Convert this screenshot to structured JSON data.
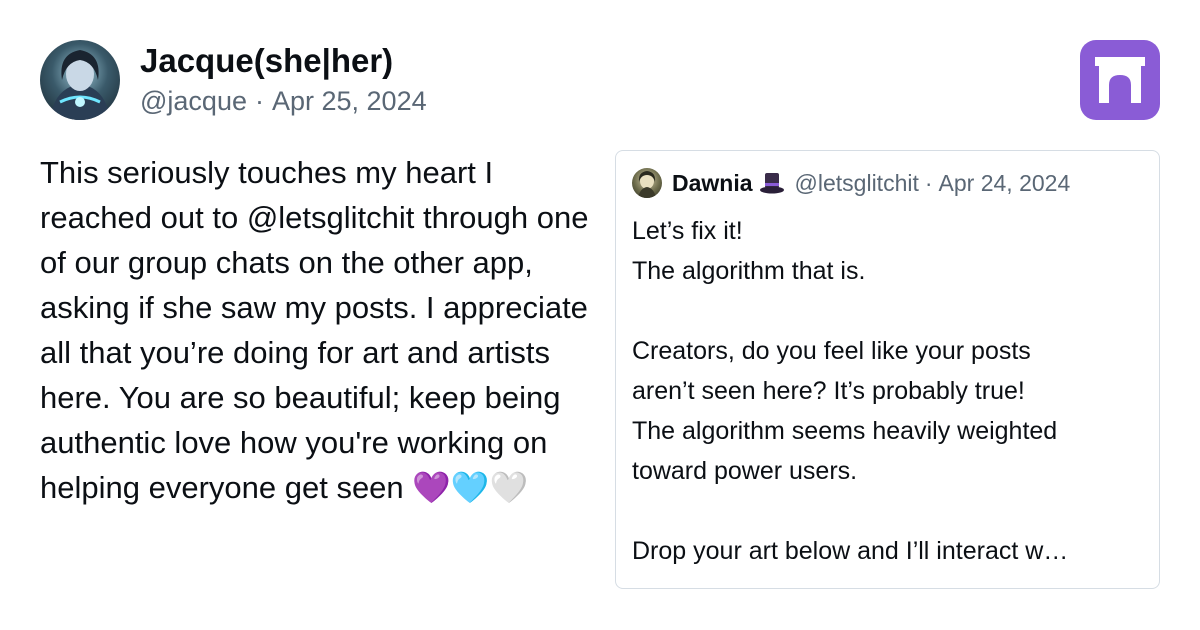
{
  "post": {
    "author": {
      "display_name": "Jacque(she|her)",
      "handle": "@jacque",
      "separator": "·",
      "date": "Apr 25, 2024"
    },
    "text": "This seriously touches my heart I reached out to @letsglitchit through one of our group chats on the other app, asking if she saw my posts. I appreciate all that you’re doing for art and artists here. You are so beautiful; keep being authentic love how you're working on helping everyone get seen ",
    "emoji": "💜",
    "emoji_tail": "🩵🤍"
  },
  "quote": {
    "author": {
      "display_name": "Dawnia",
      "handle": "@letsglitchit",
      "separator": "·",
      "date": "Apr 24, 2024"
    },
    "lines": [
      "Let’s fix it!",
      "The algorithm that is.",
      "",
      "Creators, do you feel like your posts",
      "aren’t seen here? It’s probably true!",
      "The algorithm seems heavily weighted",
      "toward power users.",
      "",
      "Drop your art below and I’ll interact w…"
    ]
  },
  "icons": {
    "app_logo": "bluesky-like-arch-logo",
    "hat": "top-hat-icon"
  },
  "colors": {
    "accent": "#8a5cd6",
    "muted_text": "#5a6775",
    "border": "#d6dde4",
    "heart": "#b48be0"
  }
}
